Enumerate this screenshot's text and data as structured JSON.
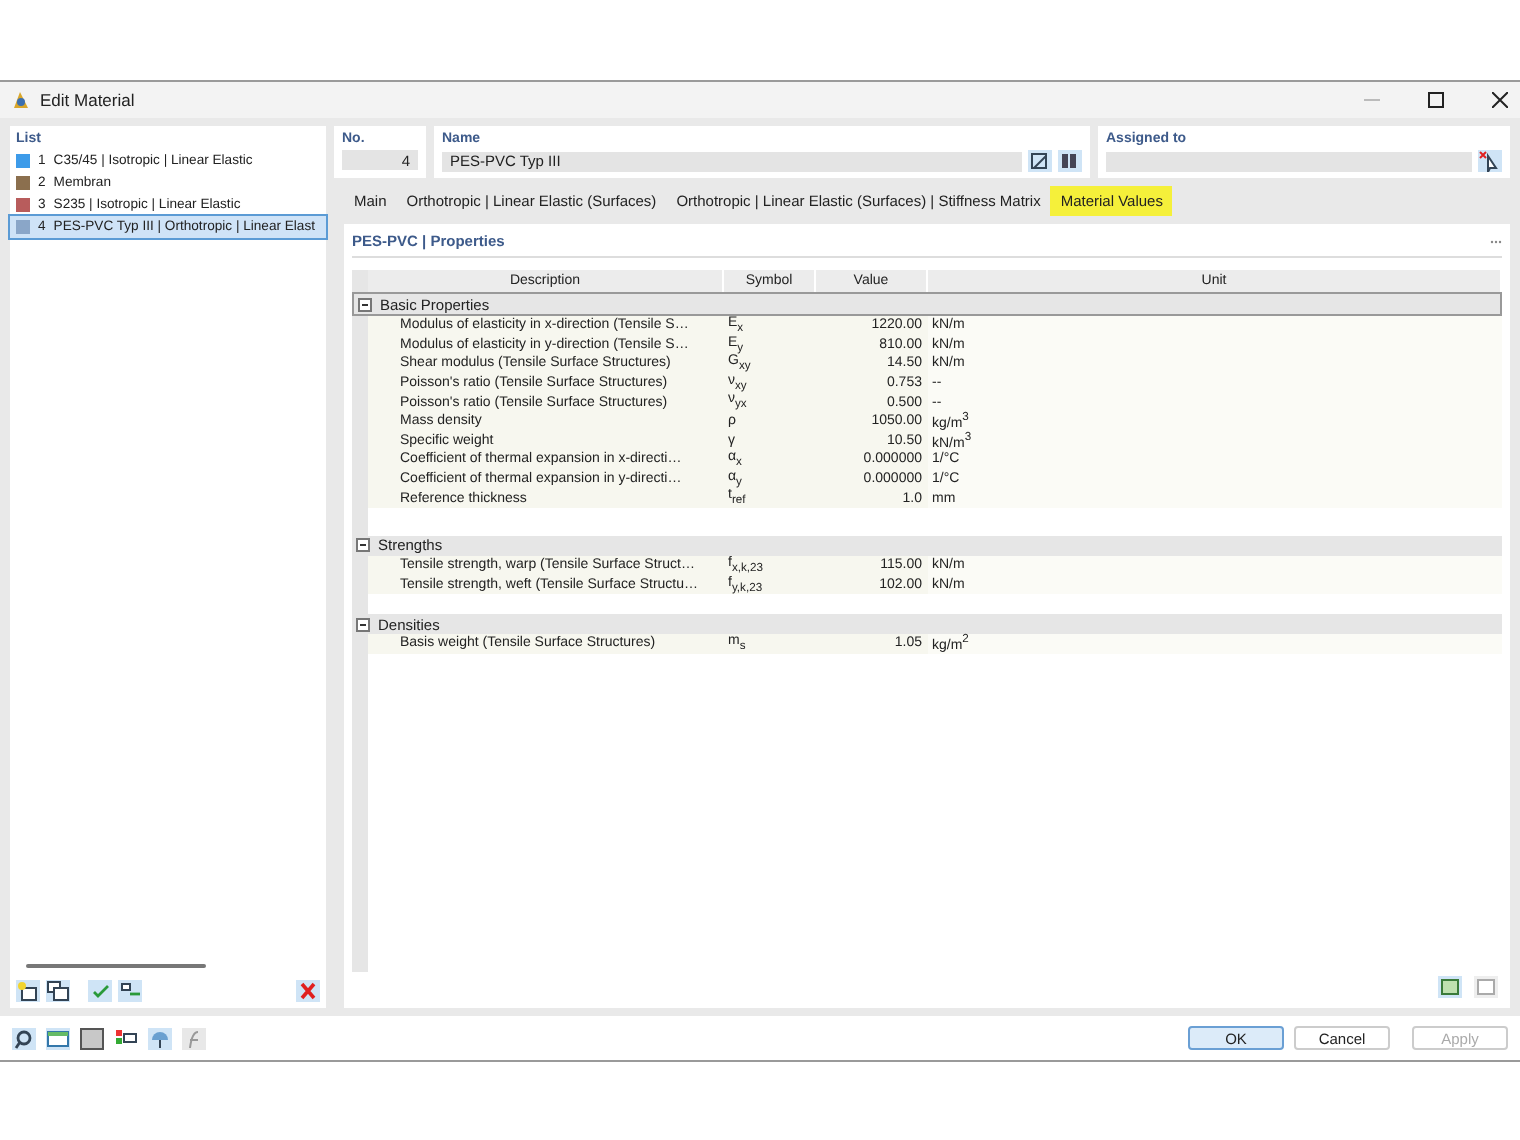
{
  "window": {
    "title": "Edit Material"
  },
  "list": {
    "title": "List",
    "items": [
      {
        "number": "1",
        "label": "C35/45 | Isotropic | Linear Elastic",
        "color": "#3d9be9",
        "selected": false
      },
      {
        "number": "2",
        "label": "Membran",
        "color": "#8b6f4e",
        "selected": false
      },
      {
        "number": "3",
        "label": "S235 | Isotropic | Linear Elastic",
        "color": "#b85c5c",
        "selected": false
      },
      {
        "number": "4",
        "label": "PES-PVC Typ III | Orthotropic | Linear Elast",
        "color": "#8aa6c8",
        "selected": true
      }
    ]
  },
  "number": {
    "label": "No.",
    "value": "4"
  },
  "name": {
    "label": "Name",
    "value": "PES-PVC Typ III"
  },
  "assigned": {
    "label": "Assigned to"
  },
  "tabs": [
    {
      "label": "Main",
      "selected": false
    },
    {
      "label": "Orthotropic | Linear Elastic (Surfaces)",
      "selected": false
    },
    {
      "label": "Orthotropic | Linear Elastic (Surfaces) | Stiffness Matrix",
      "selected": false
    },
    {
      "label": "Material Values",
      "selected": true
    }
  ],
  "section_title": "PES-PVC | Properties",
  "table": {
    "columns": [
      "Description",
      "Symbol",
      "Value",
      "Unit"
    ],
    "groups": [
      {
        "title": "Basic Properties",
        "expanded": true,
        "rows": [
          [
            "Modulus of elasticity in x-direction (Tensile S…",
            "E$_{x}$",
            "1220.00",
            "kN/m"
          ],
          [
            "Modulus of elasticity in y-direction (Tensile S…",
            "E$_{y}$",
            "810.00",
            "kN/m"
          ],
          [
            "Shear modulus (Tensile Surface Structures)",
            "G$_{xy}$",
            "14.50",
            "kN/m"
          ],
          [
            "Poisson's ratio (Tensile Surface Structures)",
            "ν$_{xy}$",
            "0.753",
            "--"
          ],
          [
            "Poisson's ratio (Tensile Surface Structures)",
            "ν$_{yx}$",
            "0.500",
            "--"
          ],
          [
            "Mass density",
            "ρ",
            "1050.00",
            "kg/m$^{3}$"
          ],
          [
            "Specific weight",
            "γ",
            "10.50",
            "kN/m$^{3}$"
          ],
          [
            "Coefficient of thermal expansion in x-directi…",
            "α$_{x}$",
            "0.000000",
            "1/°C"
          ],
          [
            "Coefficient of thermal expansion in y-directi…",
            "α$_{y}$",
            "0.000000",
            "1/°C"
          ],
          [
            "Reference thickness",
            "t$_{ref}$",
            "1.0",
            "mm"
          ]
        ]
      },
      {
        "title": "Strengths",
        "expanded": true,
        "rows": [
          [
            "Tensile strength, warp (Tensile Surface Struct…",
            "f$_{x,k,23}$",
            "115.00",
            "kN/m"
          ],
          [
            "Tensile strength, weft (Tensile Surface Structu…",
            "f$_{y,k,23}$",
            "102.00",
            "kN/m"
          ]
        ]
      },
      {
        "title": "Densities",
        "expanded": true,
        "rows": [
          [
            "Basis weight (Tensile Surface Structures)",
            "m$_{s}$",
            "1.05",
            "kg/m$^{2}$"
          ]
        ]
      }
    ]
  },
  "buttons": [
    {
      "label": "OK",
      "disabled": false,
      "kind": "default"
    },
    {
      "label": "Cancel",
      "disabled": false,
      "kind": "normal"
    },
    {
      "label": "Apply",
      "disabled": true,
      "kind": "normal"
    }
  ]
}
